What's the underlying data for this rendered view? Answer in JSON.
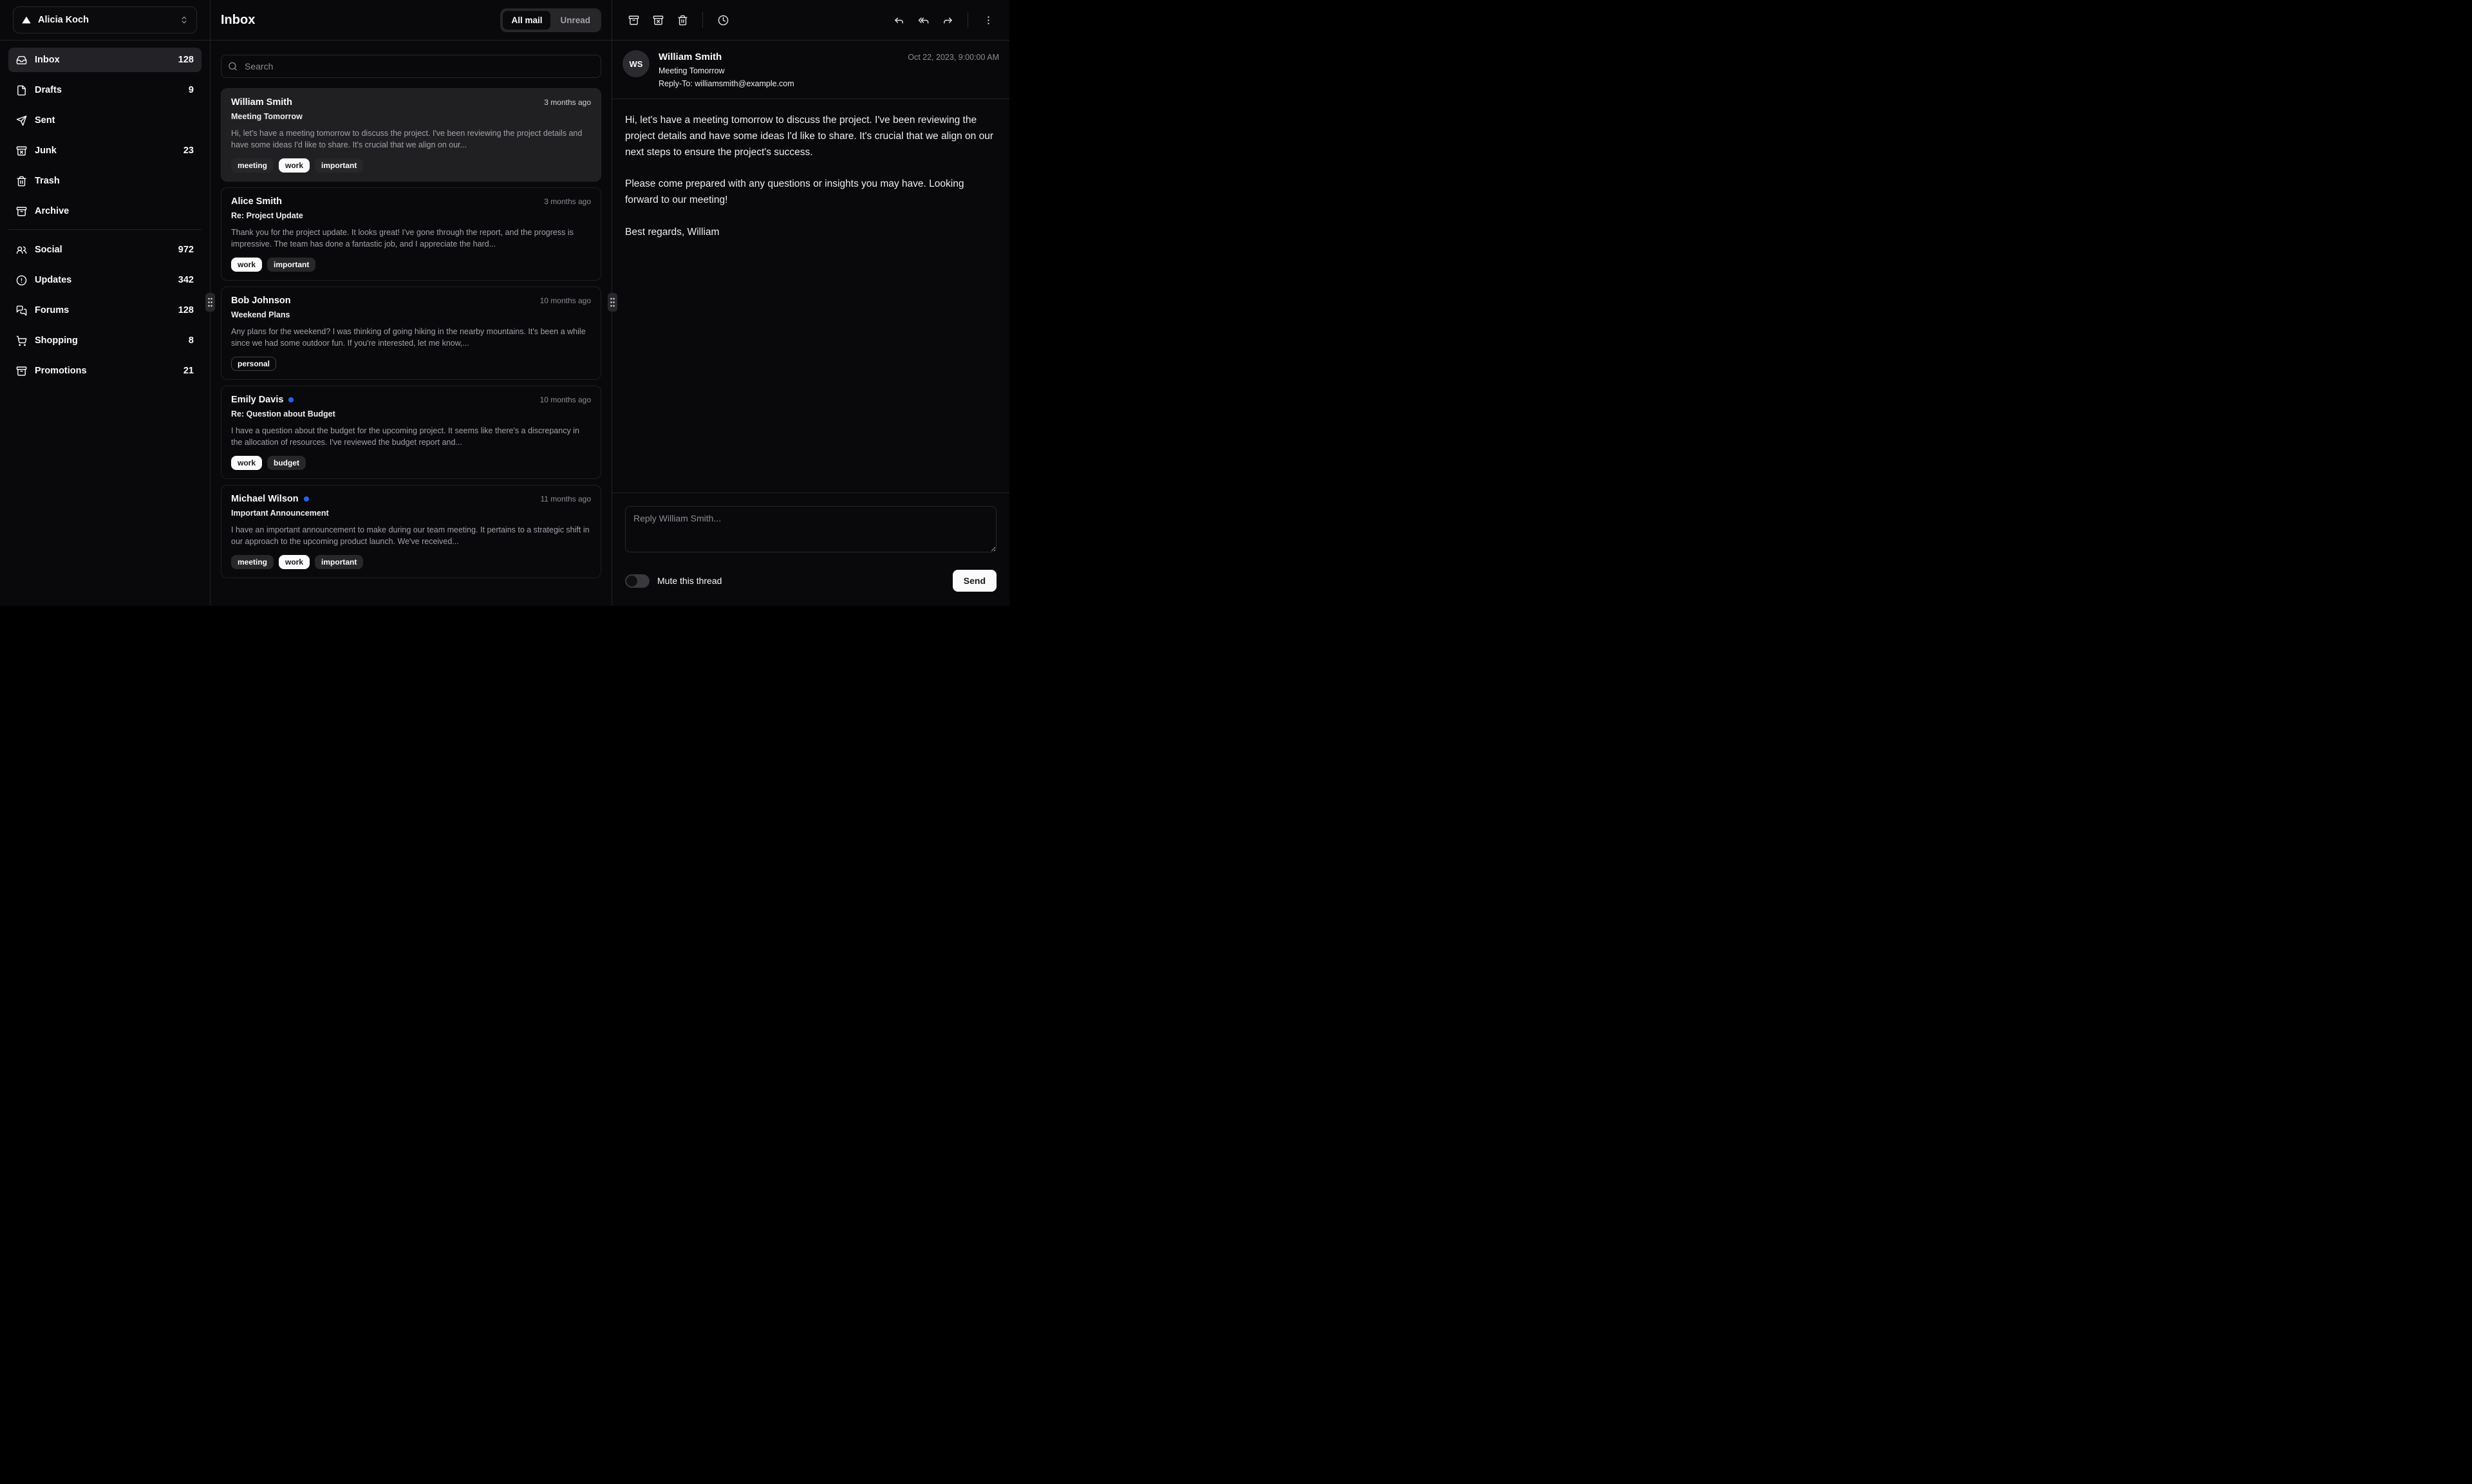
{
  "colors": {
    "background": "#09090b",
    "foreground": "#fafafa",
    "muted_foreground": "#a1a1aa",
    "accent": "#27272a",
    "selected_card_bg": "#202023",
    "unread_dot": "#2563eb",
    "badge_default_bg": "#fafafa",
    "badge_default_fg": "#18181b",
    "send_button_bg": "#fafafa"
  },
  "account": {
    "name": "Alicia Koch",
    "logo_icon": "triangle-logo-icon",
    "caret_icon": "chevrons-up-down-icon"
  },
  "sidebar": {
    "primary": [
      {
        "label": "Inbox",
        "count": "128",
        "icon": "inbox-icon",
        "active": true
      },
      {
        "label": "Drafts",
        "count": "9",
        "icon": "file-icon",
        "active": false
      },
      {
        "label": "Sent",
        "count": "",
        "icon": "send-icon",
        "active": false
      },
      {
        "label": "Junk",
        "count": "23",
        "icon": "archive-x-icon",
        "active": false
      },
      {
        "label": "Trash",
        "count": "",
        "icon": "trash-icon",
        "active": false
      },
      {
        "label": "Archive",
        "count": "",
        "icon": "archive-icon",
        "active": false
      }
    ],
    "secondary": [
      {
        "label": "Social",
        "count": "972",
        "icon": "users-icon"
      },
      {
        "label": "Updates",
        "count": "342",
        "icon": "alert-circle-icon"
      },
      {
        "label": "Forums",
        "count": "128",
        "icon": "messages-square-icon"
      },
      {
        "label": "Shopping",
        "count": "8",
        "icon": "shopping-cart-icon"
      },
      {
        "label": "Promotions",
        "count": "21",
        "icon": "archive-icon"
      }
    ]
  },
  "list_header": {
    "title": "Inbox",
    "tabs": [
      {
        "label": "All mail",
        "active": true
      },
      {
        "label": "Unread",
        "active": false
      }
    ],
    "search_placeholder": "Search"
  },
  "emails": [
    {
      "name": "William Smith",
      "time": "3 months ago",
      "subject": "Meeting Tomorrow",
      "unread": false,
      "selected": true,
      "snippet": "Hi, let's have a meeting tomorrow to discuss the project. I've been reviewing the project details and have some ideas I'd like to share. It's crucial that we align on our...",
      "labels": [
        {
          "text": "meeting",
          "variant": "secondary"
        },
        {
          "text": "work",
          "variant": "default"
        },
        {
          "text": "important",
          "variant": "secondary"
        }
      ]
    },
    {
      "name": "Alice Smith",
      "time": "3 months ago",
      "subject": "Re: Project Update",
      "unread": false,
      "selected": false,
      "snippet": "Thank you for the project update. It looks great! I've gone through the report, and the progress is impressive. The team has done a fantastic job, and I appreciate the hard...",
      "labels": [
        {
          "text": "work",
          "variant": "default"
        },
        {
          "text": "important",
          "variant": "secondary"
        }
      ]
    },
    {
      "name": "Bob Johnson",
      "time": "10 months ago",
      "subject": "Weekend Plans",
      "unread": false,
      "selected": false,
      "snippet": "Any plans for the weekend? I was thinking of going hiking in the nearby mountains. It's been a while since we had some outdoor fun. If you're interested, let me know,...",
      "labels": [
        {
          "text": "personal",
          "variant": "outline"
        }
      ]
    },
    {
      "name": "Emily Davis",
      "time": "10 months ago",
      "subject": "Re: Question about Budget",
      "unread": true,
      "selected": false,
      "snippet": "I have a question about the budget for the upcoming project. It seems like there's a discrepancy in the allocation of resources. I've reviewed the budget report and...",
      "labels": [
        {
          "text": "work",
          "variant": "default"
        },
        {
          "text": "budget",
          "variant": "secondary"
        }
      ]
    },
    {
      "name": "Michael Wilson",
      "time": "11 months ago",
      "subject": "Important Announcement",
      "unread": true,
      "selected": false,
      "snippet": "I have an important announcement to make during our team meeting. It pertains to a strategic shift in our approach to the upcoming product launch. We've received...",
      "labels": [
        {
          "text": "meeting",
          "variant": "secondary"
        },
        {
          "text": "work",
          "variant": "default"
        },
        {
          "text": "important",
          "variant": "secondary"
        }
      ]
    }
  ],
  "reading": {
    "toolbar_left_icons": [
      "archive-icon",
      "archive-x-icon",
      "trash-icon",
      "clock-icon"
    ],
    "toolbar_right_icons": [
      "reply-icon",
      "reply-all-icon",
      "forward-icon",
      "more-vertical-icon"
    ],
    "avatar_initials": "WS",
    "sender_name": "William Smith",
    "subject": "Meeting Tomorrow",
    "reply_to": "Reply-To: williamsmith@example.com",
    "date": "Oct 22, 2023, 9:00:00 AM",
    "body": "Hi, let's have a meeting tomorrow to discuss the project. I've been reviewing the project details and have some ideas I'd like to share. It's crucial that we align on our next steps to ensure the project's success.\n\nPlease come prepared with any questions or insights you may have. Looking forward to our meeting!\n\nBest regards, William",
    "reply_placeholder": "Reply William Smith...",
    "mute_label": "Mute this thread",
    "send_label": "Send"
  }
}
